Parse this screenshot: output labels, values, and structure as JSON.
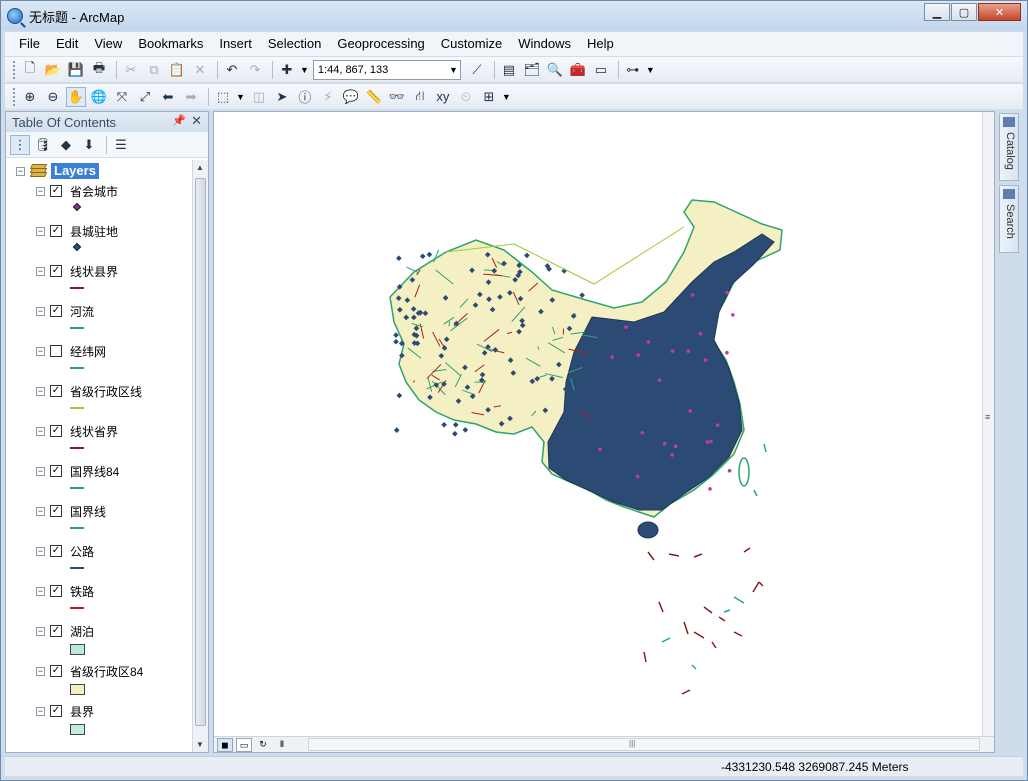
{
  "window": {
    "title": "无标题 - ArcMap"
  },
  "menu": [
    "File",
    "Edit",
    "View",
    "Bookmarks",
    "Insert",
    "Selection",
    "Geoprocessing",
    "Customize",
    "Windows",
    "Help"
  ],
  "standard_toolbar": {
    "scale": "1:44, 867, 133"
  },
  "toc": {
    "title": "Table Of Contents",
    "root_label": "Layers",
    "layers": [
      {
        "name": "省会城市",
        "checked": true,
        "symbol": "point",
        "color": "#8b2d9c"
      },
      {
        "name": "县城驻地",
        "checked": true,
        "symbol": "point",
        "color": "#2a4f7a"
      },
      {
        "name": "线状县界",
        "checked": true,
        "symbol": "line",
        "color": "#8b1a1a"
      },
      {
        "name": "河流",
        "checked": true,
        "symbol": "line",
        "color": "#2aa56a"
      },
      {
        "name": "经纬网",
        "checked": false,
        "symbol": "line",
        "color": "#2aa56a"
      },
      {
        "name": "省级行政区线",
        "checked": true,
        "symbol": "line",
        "color": "#9acd32"
      },
      {
        "name": "线状省界",
        "checked": true,
        "symbol": "line",
        "color": "#8b1a1a"
      },
      {
        "name": "国界线84",
        "checked": true,
        "symbol": "line",
        "color": "#2aa56a"
      },
      {
        "name": "国界线",
        "checked": true,
        "symbol": "line",
        "color": "#2aa56a"
      },
      {
        "name": "公路",
        "checked": true,
        "symbol": "line",
        "color": "#2a4f7a"
      },
      {
        "name": "铁路",
        "checked": true,
        "symbol": "line",
        "color": "#b22222"
      },
      {
        "name": "湖泊",
        "checked": true,
        "symbol": "polygon",
        "color": "#b8ecd8"
      },
      {
        "name": "省级行政区84",
        "checked": true,
        "symbol": "polygon",
        "color": "#f5f0c3"
      },
      {
        "name": "县界",
        "checked": true,
        "symbol": "polygon",
        "color": "#bdeee0"
      }
    ]
  },
  "dock": {
    "catalog_label": "Catalog",
    "search_label": "Search"
  },
  "status": {
    "coordinates": "-4331230.548  3269087.245 Meters"
  },
  "icons": {
    "check_mark": "✓",
    "map_fill": "#f5f0c3",
    "map_points": "#2c4b74",
    "map_roads": "#a32020"
  }
}
